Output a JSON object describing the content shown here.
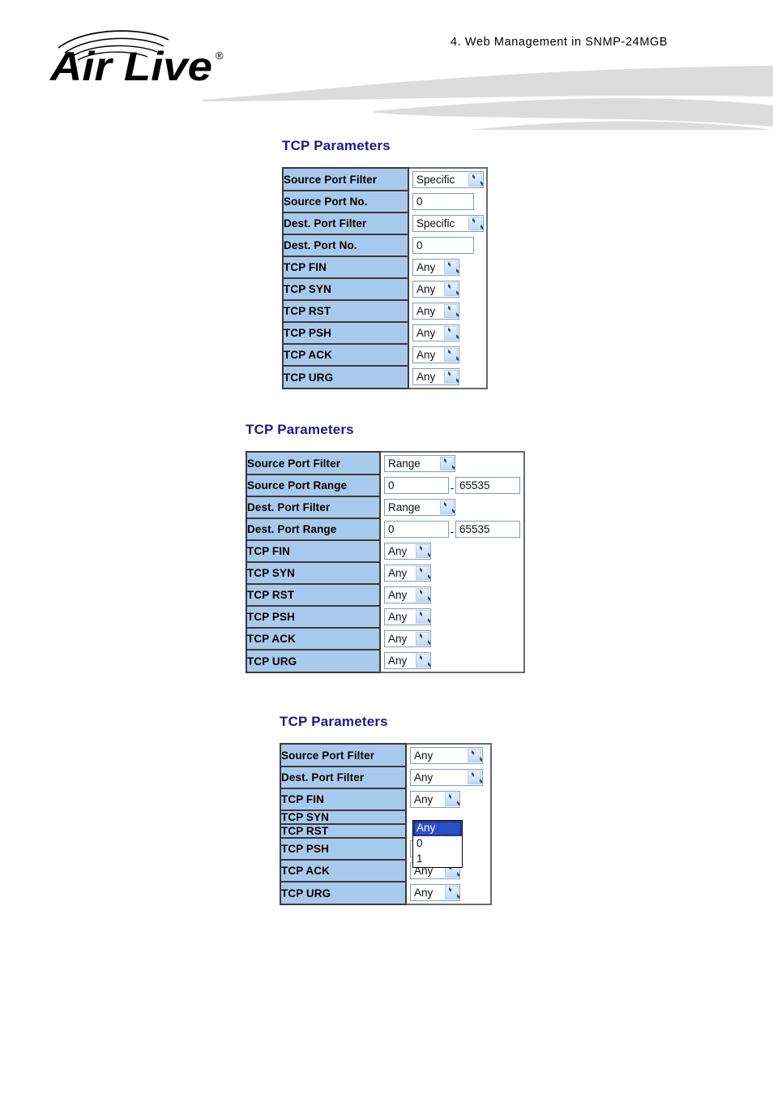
{
  "header": {
    "brand": "AirLive",
    "brand_registered_mark": "®",
    "title": "4.   Web  Management  in  SNMP-24MGB"
  },
  "sections": [
    {
      "id": "tcp-params-specific",
      "title": "TCP Parameters",
      "rows": [
        {
          "label": "Source Port Filter",
          "control": "select",
          "value": "Specific"
        },
        {
          "label": "Source Port No.",
          "control": "text",
          "value": "0"
        },
        {
          "label": "Dest. Port Filter",
          "control": "select",
          "value": "Specific"
        },
        {
          "label": "Dest. Port No.",
          "control": "text",
          "value": "0"
        },
        {
          "label": "TCP FIN",
          "control": "select",
          "value": "Any"
        },
        {
          "label": "TCP SYN",
          "control": "select",
          "value": "Any"
        },
        {
          "label": "TCP RST",
          "control": "select",
          "value": "Any"
        },
        {
          "label": "TCP PSH",
          "control": "select",
          "value": "Any"
        },
        {
          "label": "TCP ACK",
          "control": "select",
          "value": "Any"
        },
        {
          "label": "TCP URG",
          "control": "select",
          "value": "Any"
        }
      ]
    },
    {
      "id": "tcp-params-range",
      "title": "TCP Parameters",
      "rows": [
        {
          "label": "Source Port Filter",
          "control": "select",
          "value": "Range"
        },
        {
          "label": "Source Port Range",
          "control": "range",
          "value_from": "0",
          "value_to": "65535",
          "separator": "-"
        },
        {
          "label": "Dest. Port Filter",
          "control": "select",
          "value": "Range"
        },
        {
          "label": "Dest. Port Range",
          "control": "range",
          "value_from": "0",
          "value_to": "65535",
          "separator": "-"
        },
        {
          "label": "TCP FIN",
          "control": "select",
          "value": "Any"
        },
        {
          "label": "TCP SYN",
          "control": "select",
          "value": "Any"
        },
        {
          "label": "TCP RST",
          "control": "select",
          "value": "Any"
        },
        {
          "label": "TCP PSH",
          "control": "select",
          "value": "Any"
        },
        {
          "label": "TCP ACK",
          "control": "select",
          "value": "Any"
        },
        {
          "label": "TCP URG",
          "control": "select",
          "value": "Any"
        }
      ]
    },
    {
      "id": "tcp-params-any",
      "title": "TCP Parameters",
      "rows": [
        {
          "label": "Source Port Filter",
          "control": "select",
          "value": "Any"
        },
        {
          "label": "Dest. Port Filter",
          "control": "select",
          "value": "Any"
        },
        {
          "label": "TCP FIN",
          "control": "select",
          "value": "Any",
          "expanded": true
        },
        {
          "label": "TCP SYN",
          "control": "none"
        },
        {
          "label": "TCP RST",
          "control": "none"
        },
        {
          "label": "TCP PSH",
          "control": "select",
          "value": "Any"
        },
        {
          "label": "TCP ACK",
          "control": "select",
          "value": "Any"
        },
        {
          "label": "TCP URG",
          "control": "select",
          "value": "Any"
        }
      ],
      "open_dropdown": {
        "options": [
          "Any",
          "0",
          "1"
        ],
        "selected": "Any"
      }
    }
  ],
  "icons": {
    "dropdown_arrow": "chevron-down-icon"
  },
  "colors": {
    "label_background": "#a9c9ec",
    "title_text": "#1a1a8c",
    "selected_option_background": "#2b4fc8",
    "swoosh": "#dcdcdc"
  }
}
